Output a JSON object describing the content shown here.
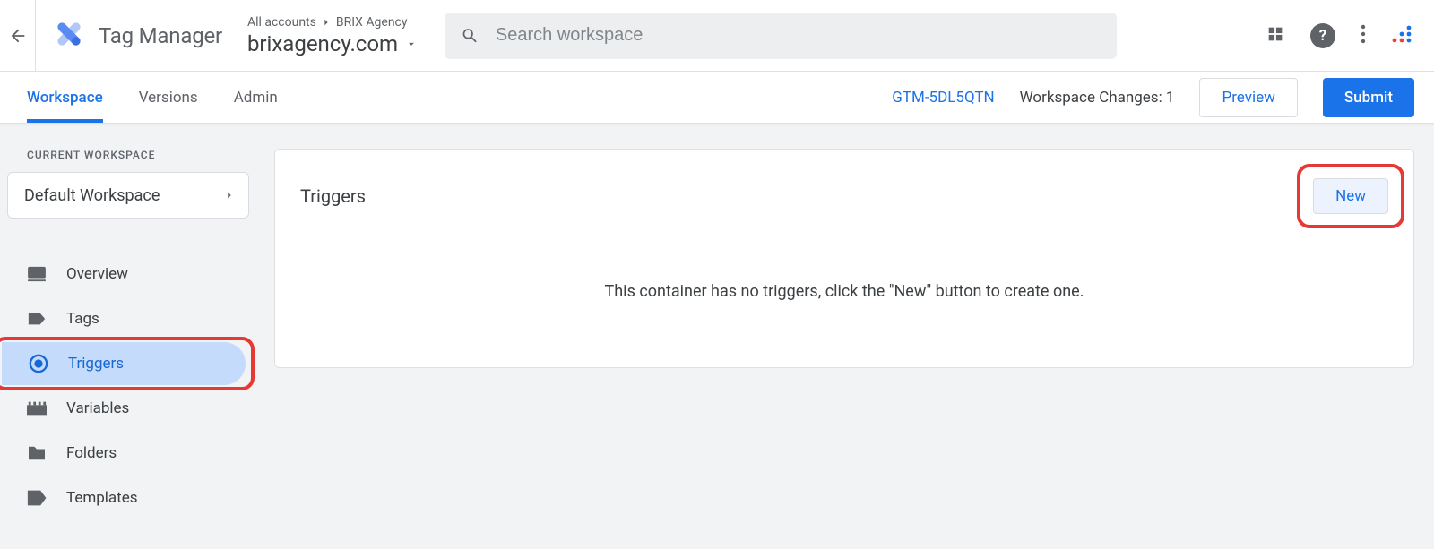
{
  "header": {
    "product": "Tag Manager",
    "breadcrumb_accounts": "All accounts",
    "breadcrumb_agency": "BRIX Agency",
    "container_name": "brixagency.com",
    "search_placeholder": "Search workspace"
  },
  "tabs": {
    "workspace": "Workspace",
    "versions": "Versions",
    "admin": "Admin"
  },
  "subheader": {
    "container_id": "GTM-5DL5QTN",
    "changes_label": "Workspace Changes: 1",
    "preview_label": "Preview",
    "submit_label": "Submit"
  },
  "sidebar": {
    "cw_label": "CURRENT WORKSPACE",
    "workspace_name": "Default Workspace",
    "items": [
      {
        "label": "Overview"
      },
      {
        "label": "Tags"
      },
      {
        "label": "Triggers"
      },
      {
        "label": "Variables"
      },
      {
        "label": "Folders"
      },
      {
        "label": "Templates"
      }
    ]
  },
  "main": {
    "card_title": "Triggers",
    "new_label": "New",
    "empty_message": "This container has no triggers, click the \"New\" button to create one."
  }
}
